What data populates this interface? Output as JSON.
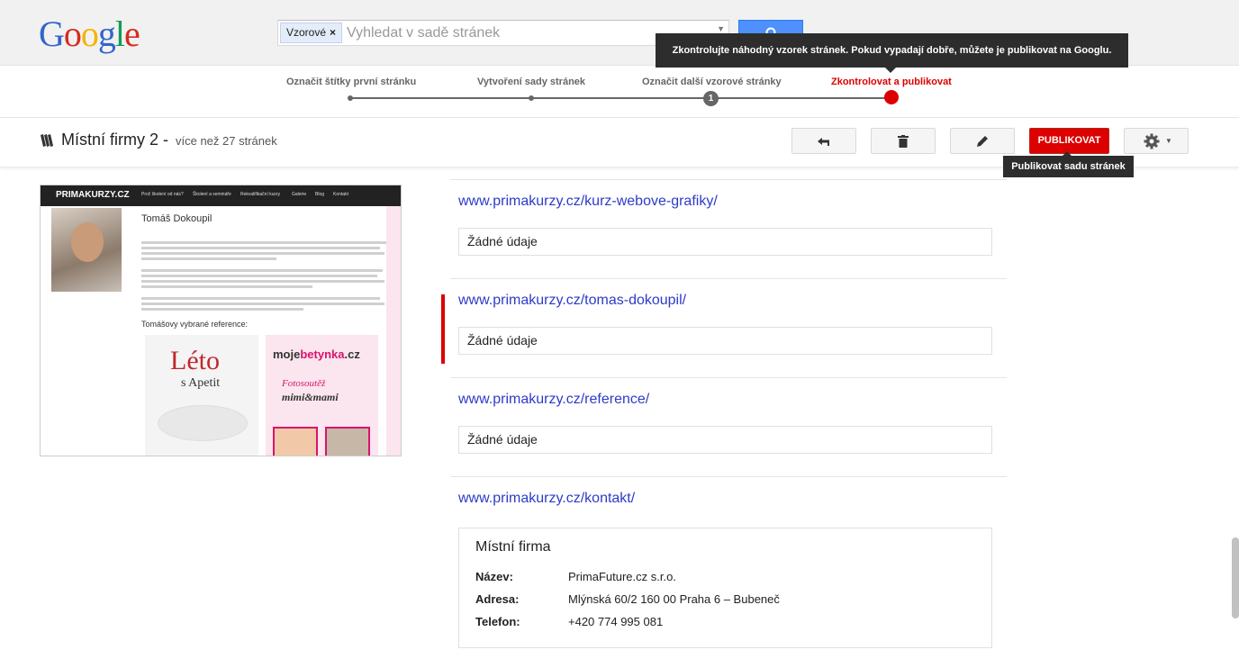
{
  "header": {
    "logo": "Google",
    "search_chip": "Vzorové",
    "search_chip_close": "×",
    "search_placeholder": "Vyhledat v sadě stránek",
    "tooltip": "Zkontrolujte náhodný vzorek stránek. Pokud vypadají dobře, můžete je publikovat na Googlu."
  },
  "steps": [
    {
      "label": "Označit štítky první stránku"
    },
    {
      "label": "Vytvoření sady stránek"
    },
    {
      "label": "Označit další vzorové stránky",
      "badge": "1"
    },
    {
      "label": "Zkontrolovat a publikovat",
      "active": true
    }
  ],
  "toolbar": {
    "set_name": "Místní firmy 2",
    "dash": "-",
    "set_count": "více než 27 stránek",
    "publish_label": "PUBLIKOVAT",
    "publish_tooltip": "Publikovat sadu stránek"
  },
  "preview": {
    "site_logo": "PRIMAKURZY.CZ",
    "menu": [
      "Proč školení od nás?",
      "Školení a semináře",
      "Rekvalifikační kurzy",
      "Galerie",
      "Blog",
      "Kontakt"
    ],
    "person_name": "Tomáš Dokoupil",
    "references_heading": "Tomášovy vybrané reference:",
    "ref1_title": "Léto",
    "ref1_sub": "s Apetit",
    "ref2_pre": "moje",
    "ref2_brand": "betynka",
    "ref2_suffix": ".cz",
    "ref2_line1": "Fotosoutěž",
    "ref2_line2": "mimi&mami"
  },
  "pages": [
    {
      "url": "www.primakurzy.cz/kurz-webove-grafiky/",
      "status": "Žádné údaje"
    },
    {
      "url": "www.primakurzy.cz/tomas-dokoupil/",
      "status": "Žádné údaje",
      "selected": true
    },
    {
      "url": "www.primakurzy.cz/reference/",
      "status": "Žádné údaje"
    },
    {
      "url": "www.primakurzy.cz/kontakt/"
    }
  ],
  "business": {
    "type": "Místní firma",
    "fields": [
      {
        "label": "Název:",
        "value": "PrimaFuture.cz s.r.o."
      },
      {
        "label": "Adresa:",
        "value": "Mlýnská 60/2 160 00 Praha 6 – Bubeneč"
      },
      {
        "label": "Telefon:",
        "value": "+420 774 995 081"
      }
    ]
  },
  "colors": {
    "accent_red": "#dd0000",
    "link": "#2d3bc8",
    "search_blue": "#4d90fe"
  }
}
